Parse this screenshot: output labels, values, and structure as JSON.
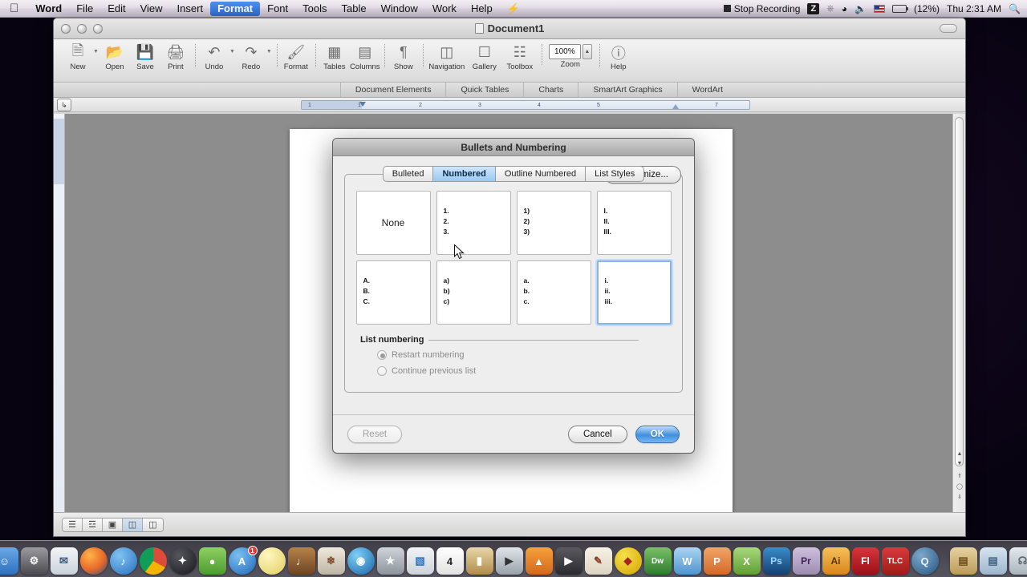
{
  "menubar": {
    "apple_icon": "apple-logo",
    "items": [
      {
        "label": "Word",
        "bold": true,
        "active": false
      },
      {
        "label": "File",
        "bold": false,
        "active": false
      },
      {
        "label": "Edit",
        "bold": false,
        "active": false
      },
      {
        "label": "View",
        "bold": false,
        "active": false
      },
      {
        "label": "Insert",
        "bold": false,
        "active": false
      },
      {
        "label": "Format",
        "bold": true,
        "active": true
      },
      {
        "label": "Font",
        "bold": false,
        "active": false
      },
      {
        "label": "Tools",
        "bold": false,
        "active": false
      },
      {
        "label": "Table",
        "bold": false,
        "active": false
      },
      {
        "label": "Window",
        "bold": false,
        "active": false
      },
      {
        "label": "Work",
        "bold": false,
        "active": false
      },
      {
        "label": "Help",
        "bold": false,
        "active": false
      }
    ],
    "status": {
      "stop_recording": "Stop Recording",
      "zoom_badge": "Z",
      "bluetooth_icon": "bluetooth-icon",
      "wifi_icon": "wifi-icon",
      "volume_icon": "volume-icon",
      "input_flag": "us-flag-icon",
      "battery_icon": "battery-icon",
      "battery_percent": "(12%)",
      "clock": "Thu 2:31 AM",
      "spotlight_icon": "search-icon"
    }
  },
  "word_window": {
    "document_title": "Document1",
    "toolbar_groups": [
      {
        "buttons": [
          {
            "label": "New",
            "icon": "new-document-icon",
            "arrow": true
          },
          {
            "label": "Open",
            "icon": "open-folder-icon",
            "arrow": false
          },
          {
            "label": "Save",
            "icon": "save-disk-icon",
            "arrow": false
          },
          {
            "label": "Print",
            "icon": "printer-icon",
            "arrow": false
          }
        ]
      },
      {
        "buttons": [
          {
            "label": "Undo",
            "icon": "undo-arrow-icon",
            "arrow": true
          },
          {
            "label": "Redo",
            "icon": "redo-arrow-icon",
            "arrow": true
          }
        ]
      },
      {
        "buttons": [
          {
            "label": "Format",
            "icon": "format-painter-icon",
            "arrow": false
          }
        ]
      },
      {
        "buttons": [
          {
            "label": "Tables",
            "icon": "table-grid-icon",
            "arrow": false
          },
          {
            "label": "Columns",
            "icon": "columns-icon",
            "arrow": false
          }
        ]
      },
      {
        "buttons": [
          {
            "label": "Show",
            "icon": "pilcrow-icon",
            "arrow": false
          }
        ]
      },
      {
        "buttons": [
          {
            "label": "Navigation",
            "icon": "navigation-pane-icon",
            "arrow": false
          },
          {
            "label": "Gallery",
            "icon": "gallery-icon",
            "arrow": false
          },
          {
            "label": "Toolbox",
            "icon": "toolbox-icon",
            "arrow": false
          }
        ]
      }
    ],
    "zoom": {
      "value": "100%",
      "label": "Zoom",
      "stepper_icon": "stepper-icon"
    },
    "help": {
      "label": "Help",
      "icon": "help-question-icon"
    },
    "ribbon_tabs": [
      {
        "label": "Document Elements"
      },
      {
        "label": "Quick Tables"
      },
      {
        "label": "Charts"
      },
      {
        "label": "SmartArt Graphics"
      },
      {
        "label": "WordArt"
      }
    ],
    "ruler": {
      "tab_selector_icon": "tab-stop-icon",
      "marks": [
        "1",
        "1",
        "2",
        "3",
        "4",
        "5",
        "7"
      ]
    },
    "status_view_buttons": [
      {
        "icon": "draft-view-icon",
        "active": false
      },
      {
        "icon": "outline-view-icon",
        "active": false
      },
      {
        "icon": "publishing-view-icon",
        "active": false
      },
      {
        "icon": "print-layout-view-icon",
        "active": true
      },
      {
        "icon": "notebook-view-icon",
        "active": false
      }
    ],
    "scrollbar": {
      "up_arrow_icon": "scroll-up-icon",
      "down_arrow_icon": "scroll-down-icon",
      "prev_page_icon": "previous-page-icon",
      "browse_object_icon": "select-browse-object-icon",
      "next_page_icon": "next-page-icon"
    }
  },
  "dialog": {
    "title": "Bullets and Numbering",
    "tabs": [
      {
        "label": "Bulleted",
        "selected": false
      },
      {
        "label": "Numbered",
        "selected": true
      },
      {
        "label": "Outline Numbered",
        "selected": false
      },
      {
        "label": "List Styles",
        "selected": false
      }
    ],
    "tiles": [
      {
        "name": "none",
        "none_label": "None",
        "markers": [],
        "selected": false
      },
      {
        "name": "decimal-period",
        "none_label": "",
        "markers": [
          "1.",
          "2.",
          "3."
        ],
        "selected": false
      },
      {
        "name": "decimal-paren",
        "none_label": "",
        "markers": [
          "1)",
          "2)",
          "3)"
        ],
        "selected": false
      },
      {
        "name": "upper-roman",
        "none_label": "",
        "markers": [
          "I.",
          "II.",
          "III."
        ],
        "selected": false
      },
      {
        "name": "upper-alpha-period",
        "none_label": "",
        "markers": [
          "A.",
          "B.",
          "C."
        ],
        "selected": false
      },
      {
        "name": "lower-alpha-paren",
        "none_label": "",
        "markers": [
          "a)",
          "b)",
          "c)"
        ],
        "selected": false
      },
      {
        "name": "lower-alpha-period",
        "none_label": "",
        "markers": [
          "a.",
          "b.",
          "c."
        ],
        "selected": false
      },
      {
        "name": "lower-roman",
        "none_label": "",
        "markers": [
          "i.",
          "ii.",
          "iii."
        ],
        "selected": true
      }
    ],
    "list_numbering": {
      "section_label": "List numbering",
      "options": [
        {
          "label": "Restart numbering",
          "checked": true,
          "disabled": true
        },
        {
          "label": "Continue previous list",
          "checked": false,
          "disabled": true
        }
      ]
    },
    "customize_label": "Customize...",
    "footer": {
      "reset_label": "Reset",
      "cancel_label": "Cancel",
      "ok_label": "OK"
    }
  },
  "dock": {
    "items": [
      {
        "name": "finder",
        "color": "#3b7fd4",
        "glyph": "☻",
        "badge": ""
      },
      {
        "name": "system-preferences",
        "color": "#8f8f93",
        "glyph": "⚙",
        "badge": ""
      },
      {
        "name": "mail",
        "color": "#dfe7ef",
        "glyph": "✉",
        "badge": ""
      },
      {
        "name": "firefox",
        "color": "#e8692a",
        "glyph": "🦊",
        "badge": ""
      },
      {
        "name": "itunes",
        "color": "#3a8fdc",
        "glyph": "♪",
        "badge": ""
      },
      {
        "name": "google-chrome",
        "color": "#dd4b39",
        "glyph": "◉",
        "badge": ""
      },
      {
        "name": "ninja-app",
        "color": "#2d2d33",
        "glyph": "✦",
        "badge": ""
      },
      {
        "name": "evernote",
        "color": "#6abd45",
        "glyph": "🐘",
        "badge": ""
      },
      {
        "name": "app-store",
        "color": "#2f8fe0",
        "glyph": "A",
        "badge": "1"
      },
      {
        "name": "photo-booth",
        "color": "#e8d45a",
        "glyph": "☀",
        "badge": ""
      },
      {
        "name": "garageband",
        "color": "#8a5a32",
        "glyph": "🎸",
        "badge": ""
      },
      {
        "name": "iphoto",
        "color": "#d8d3c6",
        "glyph": "❀",
        "badge": ""
      },
      {
        "name": "idvd",
        "color": "#2a7fd0",
        "glyph": "◎",
        "badge": ""
      },
      {
        "name": "imovie",
        "color": "#9aa0a6",
        "glyph": "★",
        "badge": ""
      },
      {
        "name": "numbers",
        "color": "#d9dde2",
        "glyph": "▥",
        "badge": ""
      },
      {
        "name": "calendar",
        "color": "#f2f2f2",
        "glyph": "4",
        "badge": ""
      },
      {
        "name": "keynote",
        "color": "#c9a05a",
        "glyph": "▭",
        "badge": ""
      },
      {
        "name": "quicktime-player",
        "color": "#b9bec4",
        "glyph": "▶",
        "badge": ""
      },
      {
        "name": "vlc",
        "color": "#e8761b",
        "glyph": "▲",
        "badge": ""
      },
      {
        "name": "movie-player",
        "color": "#4a4a4f",
        "glyph": "▶",
        "badge": ""
      },
      {
        "name": "sketchbook",
        "color": "#e9e4da",
        "glyph": "✎",
        "badge": ""
      },
      {
        "name": "after-effects-alt",
        "color": "#e7c71f",
        "glyph": "◆",
        "badge": ""
      },
      {
        "name": "dreamweaver",
        "color": "#3f8a3f",
        "glyph": "Dw",
        "badge": ""
      },
      {
        "name": "microsoft-word",
        "color": "#6fb2dd",
        "glyph": "W",
        "badge": ""
      },
      {
        "name": "powerpoint",
        "color": "#e07b3a",
        "glyph": "P",
        "badge": ""
      },
      {
        "name": "excel",
        "color": "#7fbf4d",
        "glyph": "X",
        "badge": ""
      },
      {
        "name": "photoshop",
        "color": "#2a6fa8",
        "glyph": "Ps",
        "badge": ""
      },
      {
        "name": "premiere-pro",
        "color": "#b9a7c9",
        "glyph": "Pr",
        "badge": ""
      },
      {
        "name": "illustrator",
        "color": "#e8a33d",
        "glyph": "Ai",
        "badge": ""
      },
      {
        "name": "flash",
        "color": "#c8262d",
        "glyph": "Fl",
        "badge": ""
      },
      {
        "name": "tlc",
        "color": "#cc2a2a",
        "glyph": "TLC",
        "badge": ""
      },
      {
        "name": "quicktime",
        "color": "#3b6fa0",
        "glyph": "Q",
        "badge": ""
      },
      {
        "name": "documents-stack",
        "color": "#d8c08a",
        "glyph": "▤",
        "badge": ""
      },
      {
        "name": "downloads-folder",
        "color": "#b9cbdc",
        "glyph": "▤",
        "badge": ""
      },
      {
        "name": "trash",
        "color": "#cfd6db",
        "glyph": "🗑",
        "badge": ""
      }
    ]
  }
}
